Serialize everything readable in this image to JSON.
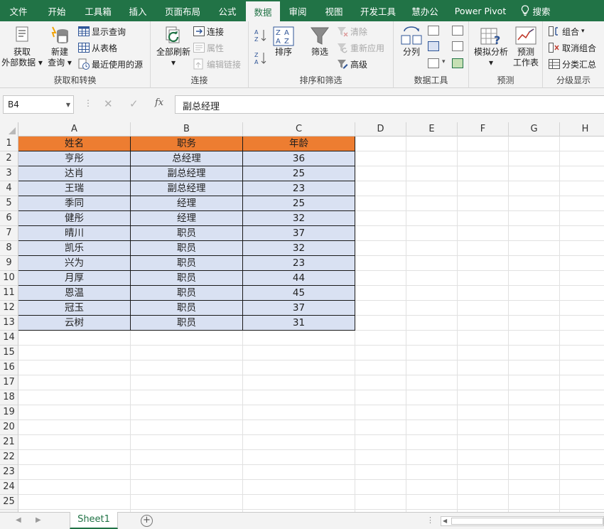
{
  "menu": {
    "tabs": [
      "文件",
      "开始",
      "工具箱",
      "插入",
      "页面布局",
      "公式",
      "数据",
      "审阅",
      "视图",
      "开发工具",
      "慧办公",
      "Power Pivot"
    ],
    "active": "数据",
    "search": "搜索"
  },
  "ribbon": {
    "get_transform": {
      "label": "获取和转换",
      "get_external": [
        "获取",
        "外部数据"
      ],
      "new_query": [
        "新建",
        "查询"
      ],
      "show_queries": "显示查询",
      "from_table": "从表格",
      "recent_sources": "最近使用的源"
    },
    "connections": {
      "label": "连接",
      "refresh_all": "全部刷新",
      "connections": "连接",
      "properties": "属性",
      "edit_links": "编辑链接"
    },
    "sort_filter": {
      "label": "排序和筛选",
      "sort": "排序",
      "filter": "筛选",
      "clear": "清除",
      "reapply": "重新应用",
      "advanced": "高级"
    },
    "data_tools": {
      "label": "数据工具",
      "text_to_columns": "分列"
    },
    "forecast": {
      "label": "预测",
      "what_if": "模拟分析",
      "forecast_sheet": [
        "预测",
        "工作表"
      ]
    },
    "outline": {
      "label": "分级显示",
      "group": "组合",
      "ungroup": "取消组合",
      "subtotal": "分类汇总"
    }
  },
  "formula_bar": {
    "name_box": "B4",
    "fx": "fx",
    "formula": "副总经理"
  },
  "grid": {
    "columns": [
      "A",
      "B",
      "C",
      "D",
      "E",
      "F",
      "G",
      "H"
    ],
    "row_count": 26,
    "table": {
      "headers": [
        "姓名",
        "职务",
        "年龄"
      ],
      "rows": [
        [
          "亨彤",
          "总经理",
          "36"
        ],
        [
          "达肖",
          "副总经理",
          "25"
        ],
        [
          "王瑞",
          "副总经理",
          "23"
        ],
        [
          "季同",
          "经理",
          "25"
        ],
        [
          "健彤",
          "经理",
          "32"
        ],
        [
          "晴川",
          "职员",
          "37"
        ],
        [
          "凯乐",
          "职员",
          "32"
        ],
        [
          "兴为",
          "职员",
          "23"
        ],
        [
          "月厚",
          "职员",
          "44"
        ],
        [
          "恩温",
          "职员",
          "45"
        ],
        [
          "冠玉",
          "职员",
          "37"
        ],
        [
          "云树",
          "职员",
          "31"
        ]
      ]
    }
  },
  "sheets": {
    "active": "Sheet1"
  },
  "colors": {
    "excel_green": "#217346",
    "header_fill": "#ed7d31",
    "body_fill": "#d9e1f2"
  }
}
